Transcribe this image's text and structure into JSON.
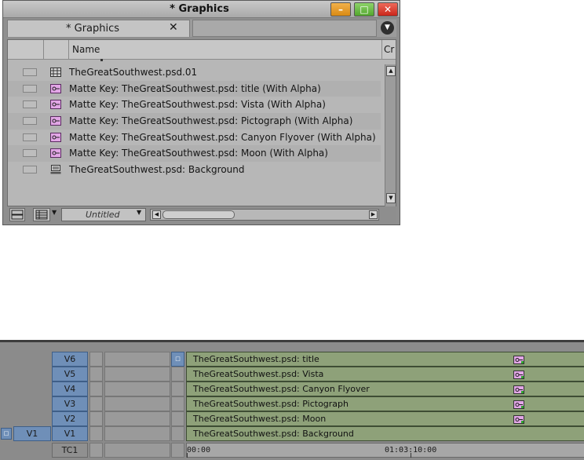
{
  "bin": {
    "window_title": "* Graphics",
    "window_buttons": {
      "minimize": "–",
      "maximize": "□",
      "close": "✕"
    },
    "tab": {
      "label": "* Graphics",
      "close": "✕"
    },
    "columns": {
      "name": "Name",
      "creation": "Cr"
    },
    "items": [
      {
        "icon": "sequence-icon",
        "name": "TheGreatSouthwest.psd.01"
      },
      {
        "icon": "matte-key-icon",
        "name": "Matte Key: TheGreatSouthwest.psd: title  (With Alpha)"
      },
      {
        "icon": "matte-key-icon",
        "name": "Matte Key: TheGreatSouthwest.psd: Vista (With Alpha)"
      },
      {
        "icon": "matte-key-icon",
        "name": "Matte Key: TheGreatSouthwest.psd: Pictograph (With Alpha)"
      },
      {
        "icon": "matte-key-icon",
        "name": "Matte Key: TheGreatSouthwest.psd: Canyon Flyover (With Alpha)"
      },
      {
        "icon": "matte-key-icon",
        "name": "Matte Key: TheGreatSouthwest.psd: Moon (With Alpha)"
      },
      {
        "icon": "master-clip-icon",
        "name": "TheGreatSouthwest.psd: Background"
      }
    ],
    "bin_view": "Untitled"
  },
  "timeline": {
    "tracks": [
      {
        "record": "V6",
        "clip": "TheGreatSouthwest.psd: title",
        "key": true
      },
      {
        "record": "V5",
        "clip": "TheGreatSouthwest.psd: Vista",
        "key": true
      },
      {
        "record": "V4",
        "clip": "TheGreatSouthwest.psd: Canyon Flyover",
        "key": true
      },
      {
        "record": "V3",
        "clip": "TheGreatSouthwest.psd: Pictograph",
        "key": true
      },
      {
        "record": "V2",
        "clip": "TheGreatSouthwest.psd: Moon",
        "key": true
      },
      {
        "record": "V1",
        "source": "V1",
        "clip": "TheGreatSouthwest.psd: Background",
        "key": false
      }
    ],
    "timecode_track": {
      "label": "TC1",
      "start": "00:00",
      "marker": "01:03:10:00"
    },
    "colors": {
      "track_blue": "#6f8fb8",
      "clip_green": "#8ea179",
      "matte_key_pink": "#e2a6e6"
    }
  }
}
